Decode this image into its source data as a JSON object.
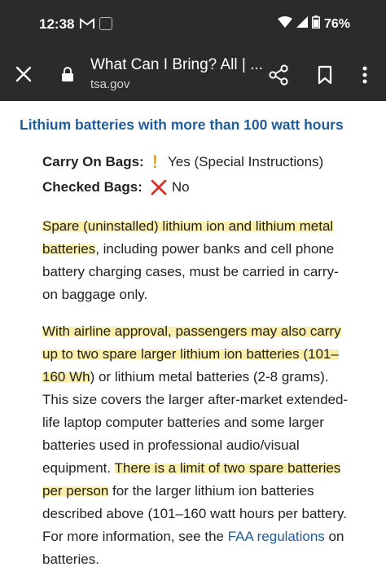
{
  "status_bar": {
    "time": "12:38",
    "battery": "76%",
    "icons": [
      "gmail-icon",
      "app-notification-icon",
      "wifi-icon",
      "signal-icon",
      "battery-icon"
    ]
  },
  "toolbar": {
    "title": "What Can I Bring? All | ...",
    "url": "tsa.gov",
    "icons": [
      "close-icon",
      "lock-icon",
      "share-icon",
      "bookmark-icon",
      "more-vert-icon"
    ]
  },
  "article": {
    "heading": "Lithium batteries with more than 100 watt hours",
    "carry_on": {
      "label": "Carry On Bags:",
      "value": "Yes (Special Instructions)"
    },
    "checked": {
      "label": "Checked Bags:",
      "value": "No"
    },
    "paragraph1": {
      "l1": "Spare (uninstalled) lithium ion and lithium metal",
      "l2a": "batteries",
      "l2b": ", including power banks and cell phone",
      "l3": "battery charging cases, must be carried in carry-",
      "l4": "on baggage only."
    },
    "paragraph2": {
      "l1": "With airline approval, passengers may also carry",
      "l2": "up to two spare larger lithium ion batteries (101–",
      "l3a": "160 Wh",
      "l3b": ") or lithium metal batteries (2-8 grams).",
      "l4": "This size covers the larger after-market extended-",
      "l5": "life laptop computer batteries and some larger",
      "l6": "batteries used in professional audio/visual",
      "l7a": "equipment. ",
      "l7b": "There is a limit of two spare batteries",
      "l8a": "per person",
      "l8b": " for the larger lithium ion batteries",
      "l9": "described above (101–160 watt hours per battery.",
      "l10a": "For more information, see the ",
      "l10link": "FAA regulations",
      "l10b": " on",
      "l11": "batteries."
    }
  },
  "colors": {
    "bar_background": "#2b2b2b",
    "heading": "#1f5c99",
    "highlight": "#fbeea8",
    "warning": "#f0a500",
    "no_mark": "#d93025"
  }
}
